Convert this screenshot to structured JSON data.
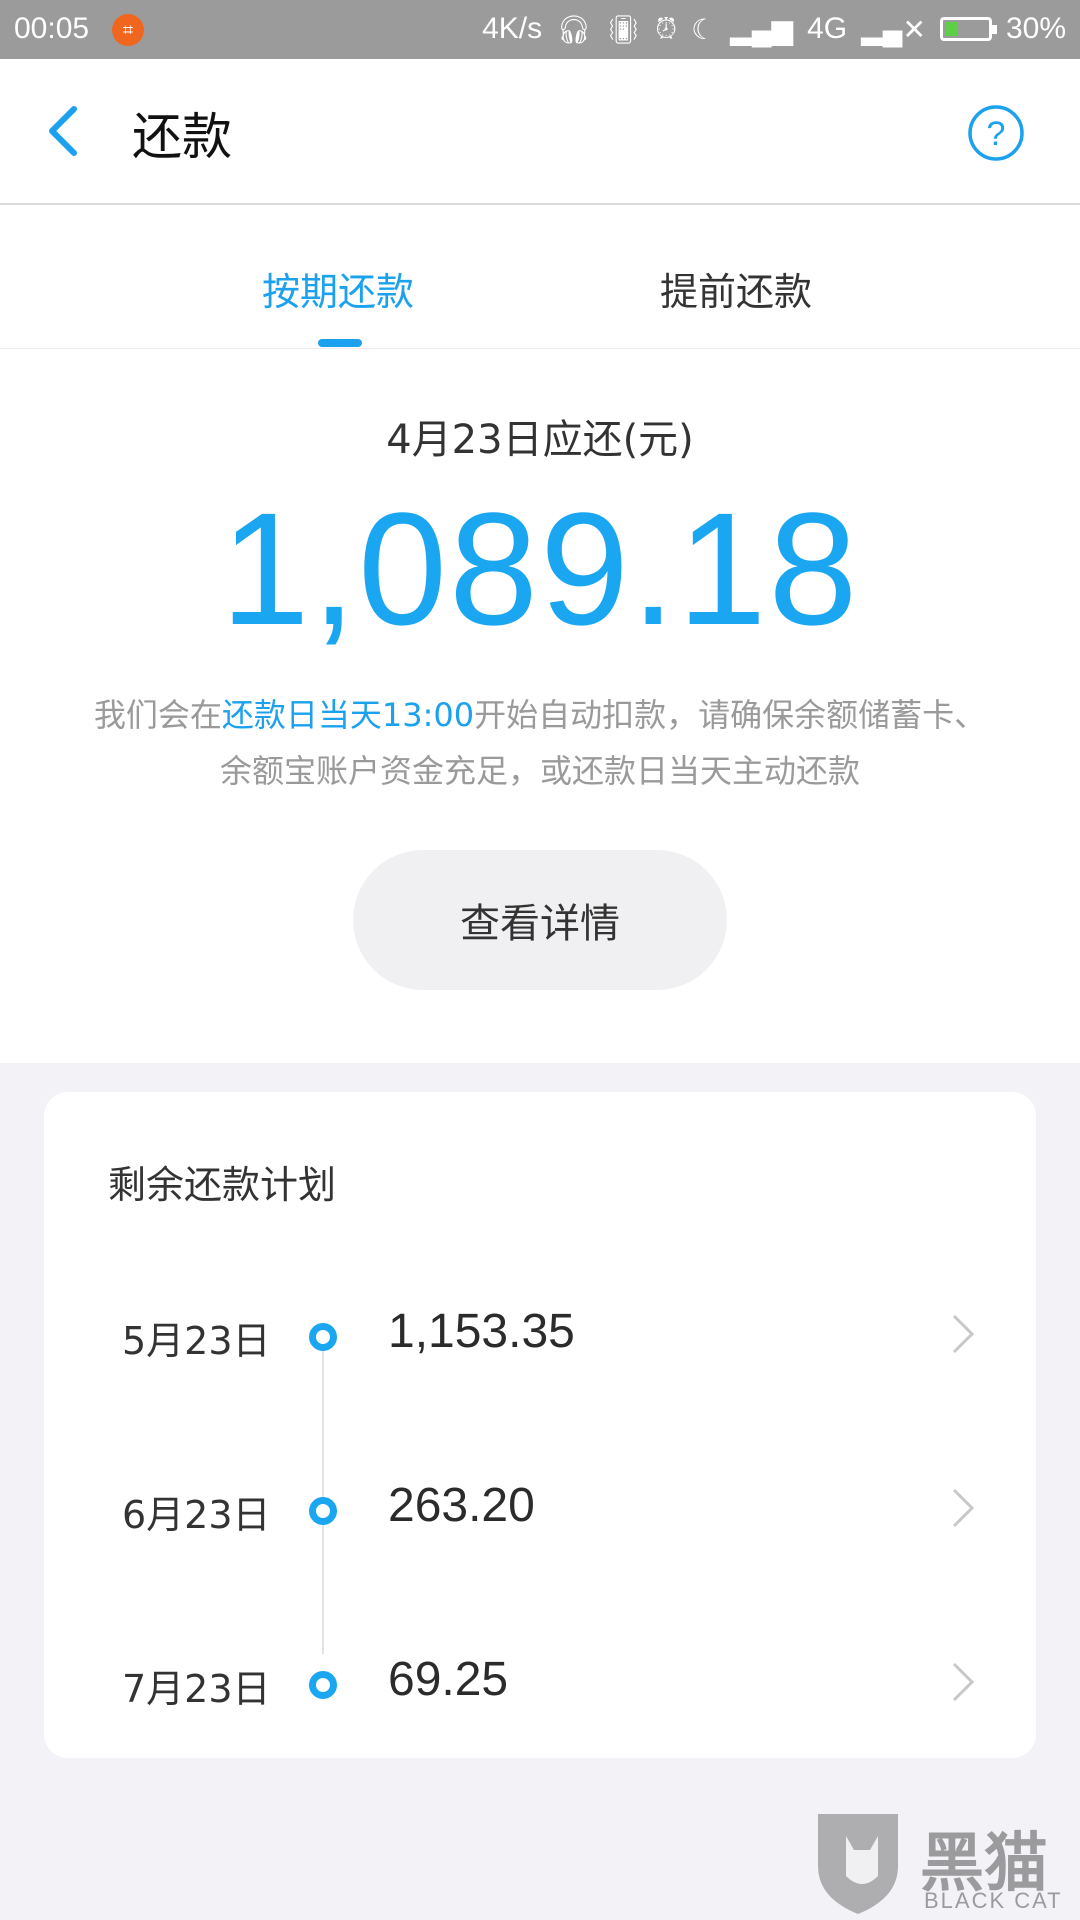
{
  "status_bar": {
    "time": "00:05",
    "net_speed": "4K/s",
    "network": "4G",
    "battery": "30%",
    "battery_level": 0.3,
    "app_indicator_icon": "crop-icon"
  },
  "header": {
    "title": "还款",
    "back_icon": "chevron-left-icon",
    "help_icon": "question-circle-icon"
  },
  "tabs": [
    {
      "label": "按期还款",
      "active": true
    },
    {
      "label": "提前还款",
      "active": false
    }
  ],
  "summary": {
    "due_label": "4月23日应还(元)",
    "due_amount": "1,089.18",
    "notice_before": "我们会在",
    "notice_highlight": "还款日当天13:00",
    "notice_after": "开始自动扣款，请确保余额储蓄卡、余额宝账户资金充足，或还款日当天主动还款",
    "details_button": "查看详情"
  },
  "plan": {
    "title": "剩余还款计划",
    "items": [
      {
        "date": "5月23日",
        "amount": "1,153.35"
      },
      {
        "date": "6月23日",
        "amount": "263.20"
      },
      {
        "date": "7月23日",
        "amount": "69.25"
      }
    ]
  },
  "watermark": {
    "text": "黑猫",
    "sub": "BLACK CAT"
  },
  "colors": {
    "accent": "#1ba1ee",
    "amount_blue": "#1ba6f2",
    "status_bar": "#9b9b9b",
    "page_bg": "#f3f3f7"
  }
}
